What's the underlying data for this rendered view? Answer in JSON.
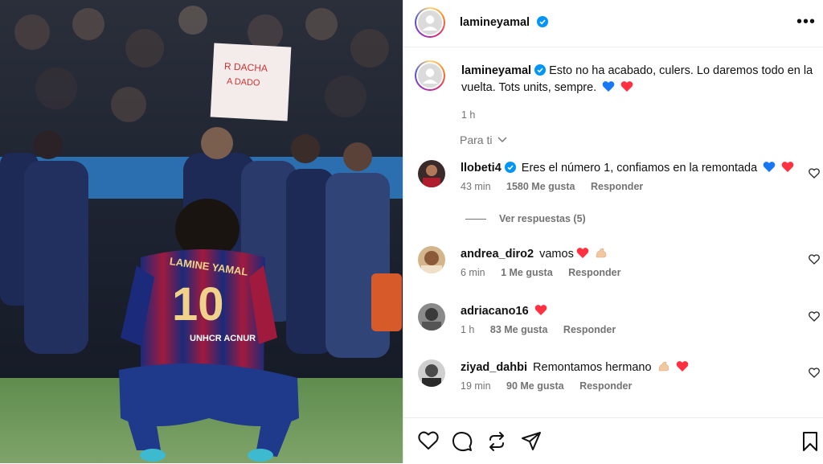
{
  "post": {
    "author": "lamineyamal",
    "more_label": "•••"
  },
  "caption": {
    "username": "lamineyamal",
    "text": "Esto no ha acabado, culers. Lo daremos todo en la vuelta. Tots units, sempre.",
    "emojis": [
      "blue-heart",
      "red-heart"
    ],
    "time": "1 h"
  },
  "photo": {
    "jersey_name": "LAMINE YAMAL",
    "jersey_number": "10",
    "sponsor": "UNHCR ACNUR"
  },
  "sort": {
    "label": "Para ti"
  },
  "comments": [
    {
      "username": "llobeti4",
      "verified": true,
      "text": "Eres el número 1, confiamos en la remontada",
      "time": "43 min",
      "likes": "1580 Me gusta",
      "reply": "Responder"
    },
    {
      "username": "andrea_diro2",
      "verified": false,
      "text": "vamos",
      "time": "6 min",
      "likes": "1 Me gusta",
      "reply": "Responder"
    },
    {
      "username": "adriacano16",
      "verified": false,
      "text": "",
      "time": "1 h",
      "likes": "83 Me gusta",
      "reply": "Responder"
    },
    {
      "username": "ziyad_dahbi",
      "verified": false,
      "text": "Remontamos hermano",
      "time": "19 min",
      "likes": "90 Me gusta",
      "reply": "Responder"
    }
  ],
  "view_replies": "Ver respuestas (5)",
  "colors": {
    "verified": "#0095f6",
    "heart_red": "#ff3040",
    "heart_blue": "#1877f2",
    "meta_gray": "#737373"
  }
}
